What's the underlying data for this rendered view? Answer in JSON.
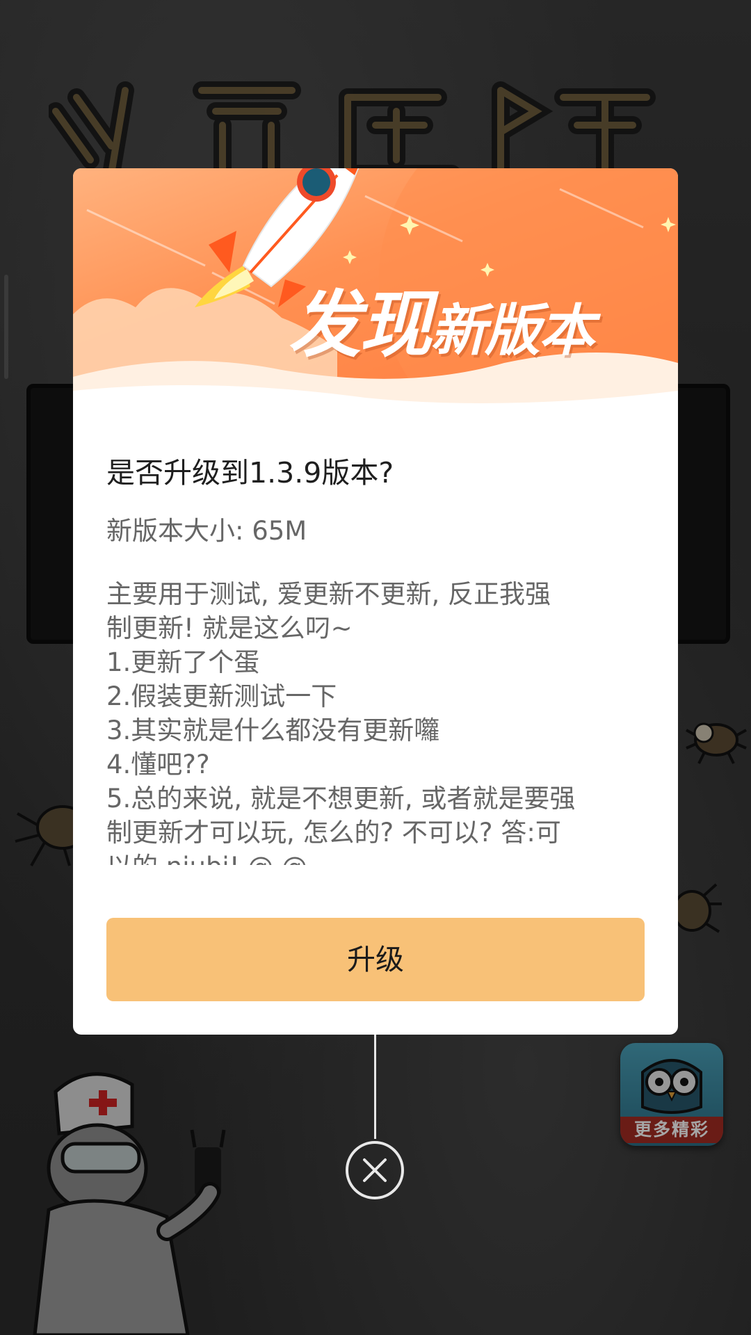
{
  "background": {
    "more_button_label": "更多精彩"
  },
  "dialog": {
    "header_title_big": "发现",
    "header_title_small": "新版本",
    "question": "是否升级到1.3.9版本?",
    "size_text": "新版本大小: 65M",
    "notes": [
      "主要用于测试, 爱更新不更新, 反正我强",
      "制更新! 就是这么叼~",
      "1.更新了个蛋",
      "2.假装更新测试一下",
      "3.其实就是什么都没有更新囖",
      "4.懂吧??",
      "5.总的来说, 就是不想更新, 或者就是要强",
      "制更新才可以玩, 怎么的? 不可以? 答:可",
      "以的 niubi! @.@"
    ],
    "upgrade_label": "升级"
  },
  "colors": {
    "header_orange": "#ff8a47",
    "button_fill": "#f8c177",
    "overlay": "rgba(0,0,0,0.35)"
  },
  "icons": {
    "close": "close-circle-icon",
    "rocket": "rocket-icon",
    "owl": "owl-icon"
  }
}
